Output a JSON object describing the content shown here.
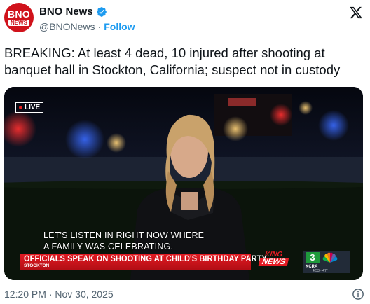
{
  "author": {
    "name": "BNO News",
    "handle": "@BNONews",
    "follow_label": "Follow",
    "avatar_text_top": "BNO",
    "avatar_text_bottom": "NEWS",
    "verified": true
  },
  "icons": {
    "platform_logo": "x-logo-icon",
    "verified": "verified-badge-icon",
    "info": "info-icon"
  },
  "tweet": {
    "text": "BREAKING: At least 4 dead, 10 injured after shooting at banquet hall in Stockton, California; suspect not in custody",
    "timestamp": "12:20 PM · Nov 30, 2025"
  },
  "media": {
    "live_label": "LIVE",
    "caption": "LET'S LISTEN IN RIGHT NOW WHERE\nA FAMILY WAS CELEBRATING.",
    "headline": "OFFICIALS SPEAK ON SHOOTING AT CHILD'S BIRTHDAY PARTY",
    "location": "STOCKTON",
    "brand_top": "KING",
    "brand_bottom": "NEWS",
    "station_number": "3",
    "station_call": "KCRA",
    "station_time": "4:53 · 47°"
  },
  "colors": {
    "accent": "#1d9bf0",
    "brand_red": "#e31b23",
    "text": "#0f1419",
    "muted": "#536471"
  }
}
